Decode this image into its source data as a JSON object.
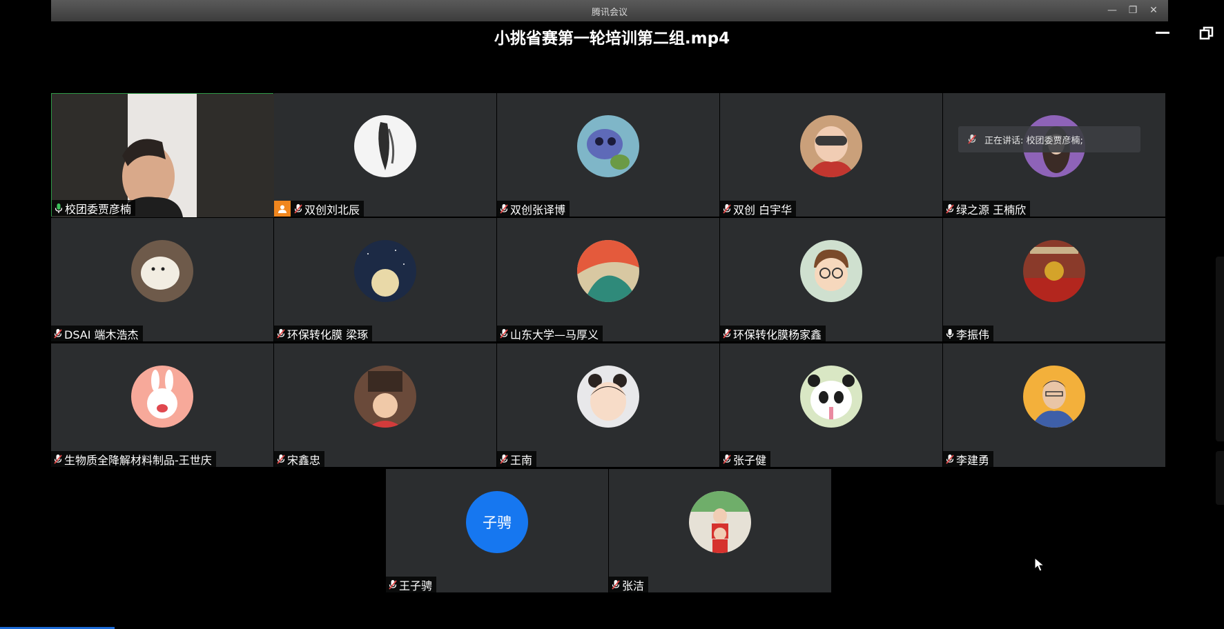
{
  "window": {
    "app_title": "腾讯会议"
  },
  "recording": {
    "file_title": "小挑省赛第一轮培训第二组.mp4"
  },
  "speaking_notice": "正在讲话: 校团委贾彦楠;",
  "participants": [
    {
      "name": "校团委贾彦楠",
      "mic": "on"
    },
    {
      "name": "双创刘北辰",
      "mic": "muted",
      "host": true
    },
    {
      "name": "双创张译博",
      "mic": "muted"
    },
    {
      "name": "双创 白宇华",
      "mic": "muted"
    },
    {
      "name": "绿之源 王楠欣",
      "mic": "muted"
    },
    {
      "name": "DSAI 端木浩杰",
      "mic": "muted"
    },
    {
      "name": "环保转化膜 梁琢",
      "mic": "muted"
    },
    {
      "name": "山东大学—马厚义",
      "mic": "muted"
    },
    {
      "name": "环保转化膜杨家鑫",
      "mic": "muted"
    },
    {
      "name": "李振伟",
      "mic": "on"
    },
    {
      "name": "生物质全降解材料制品-王世庆",
      "mic": "muted"
    },
    {
      "name": "宋鑫忠",
      "mic": "muted"
    },
    {
      "name": "王南",
      "mic": "muted"
    },
    {
      "name": "张子健",
      "mic": "muted"
    },
    {
      "name": "李建勇",
      "mic": "muted"
    },
    {
      "name": "王子骋",
      "mic": "muted",
      "initials": "子骋"
    },
    {
      "name": "张洁",
      "mic": "muted"
    }
  ],
  "colors": {
    "tile_bg": "#2b2d2f",
    "active_border": "#2f9a47",
    "host_badge": "#f0861e",
    "avatar_blue": "#1677f0",
    "mic_on": "#3cc15a",
    "mic_muted": "#e04848"
  }
}
